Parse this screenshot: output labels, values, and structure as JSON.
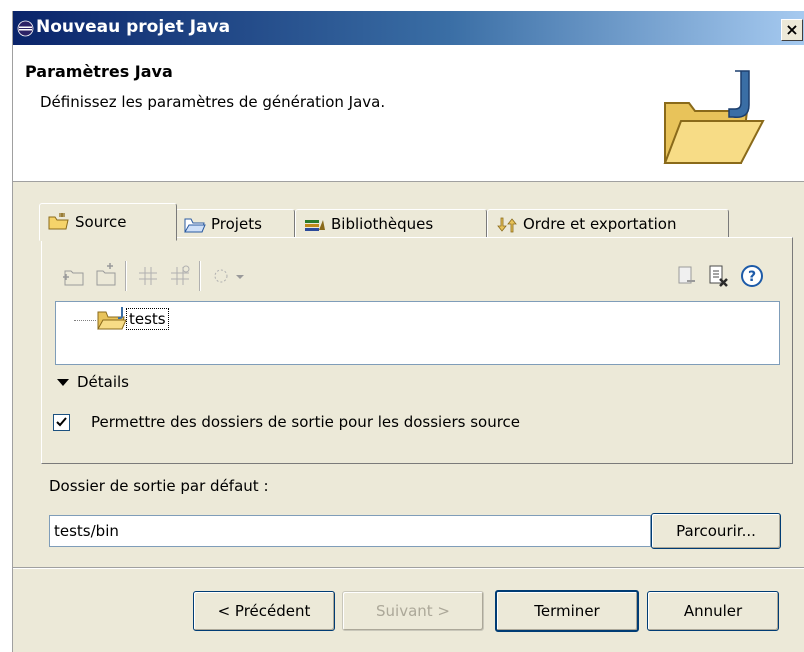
{
  "window": {
    "title": "Nouveau projet Java",
    "close_glyph": "×"
  },
  "header": {
    "title": "Paramètres Java",
    "description": "Définissez les paramètres de génération Java."
  },
  "tabs": [
    {
      "label": "Source",
      "icon": "source-folder-icon",
      "active": true
    },
    {
      "label": "Projets",
      "icon": "projects-folder-icon",
      "active": false
    },
    {
      "label": "Bibliothèques",
      "icon": "libraries-icon",
      "active": false
    },
    {
      "label": "Ordre et exportation",
      "icon": "order-export-icon",
      "active": false
    }
  ],
  "tree": {
    "items": [
      {
        "label": "tests"
      }
    ]
  },
  "details": {
    "label": "Détails",
    "allow_output_folders_label": "Permettre des dossiers de sortie pour les dossiers source",
    "allow_output_folders_checked": true
  },
  "output": {
    "label": "Dossier de sortie par défaut :",
    "value": "tests/bin",
    "browse_label": "Parcourir..."
  },
  "buttons": {
    "back": "< Précédent",
    "next": "Suivant >",
    "finish": "Terminer",
    "cancel": "Annuler"
  },
  "colors": {
    "title_bar_start": "#0a246a",
    "title_bar_end": "#a6caf0",
    "dialog_background": "#ece9d8",
    "folder_yellow": "#f5d36a",
    "java_blue": "#3a6ea5"
  }
}
